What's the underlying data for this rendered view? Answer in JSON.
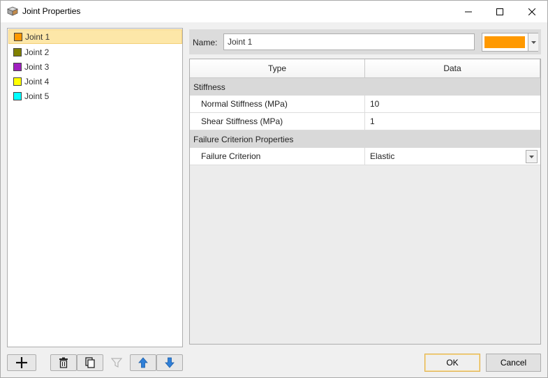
{
  "window": {
    "title": "Joint Properties",
    "icon": "cube-icon",
    "controls": [
      "minimize-icon",
      "maximize-icon",
      "close-icon"
    ]
  },
  "joints": [
    {
      "label": "Joint 1",
      "color": "#ff9900",
      "selected": true
    },
    {
      "label": "Joint 2",
      "color": "#808000",
      "selected": false
    },
    {
      "label": "Joint 3",
      "color": "#a020c0",
      "selected": false
    },
    {
      "label": "Joint 4",
      "color": "#ffff00",
      "selected": false
    },
    {
      "label": "Joint 5",
      "color": "#00ffff",
      "selected": false
    }
  ],
  "toolbar": {
    "icons": [
      "add-icon",
      "delete-icon",
      "copy-icon",
      "filter-icon",
      "move-up-icon",
      "move-down-icon"
    ]
  },
  "properties": {
    "name_label": "Name:",
    "name_value": "Joint 1",
    "color": "#ff9900"
  },
  "grid": {
    "columns": [
      "Type",
      "Data"
    ],
    "groups": [
      {
        "title": "Stiffness",
        "rows": [
          {
            "type": "Normal Stiffness (MPa)",
            "data": "10"
          },
          {
            "type": "Shear Stiffness (MPa)",
            "data": "1"
          }
        ]
      },
      {
        "title": "Failure Criterion Properties",
        "rows": [
          {
            "type": "Failure Criterion",
            "data": "Elastic",
            "dropdown": true
          }
        ]
      }
    ]
  },
  "buttons": {
    "ok": "OK",
    "cancel": "Cancel"
  },
  "colors": {
    "selection_bg": "#fde7a8",
    "ok_border": "#e2b24c",
    "arrow_blue": "#2f7fd8"
  }
}
